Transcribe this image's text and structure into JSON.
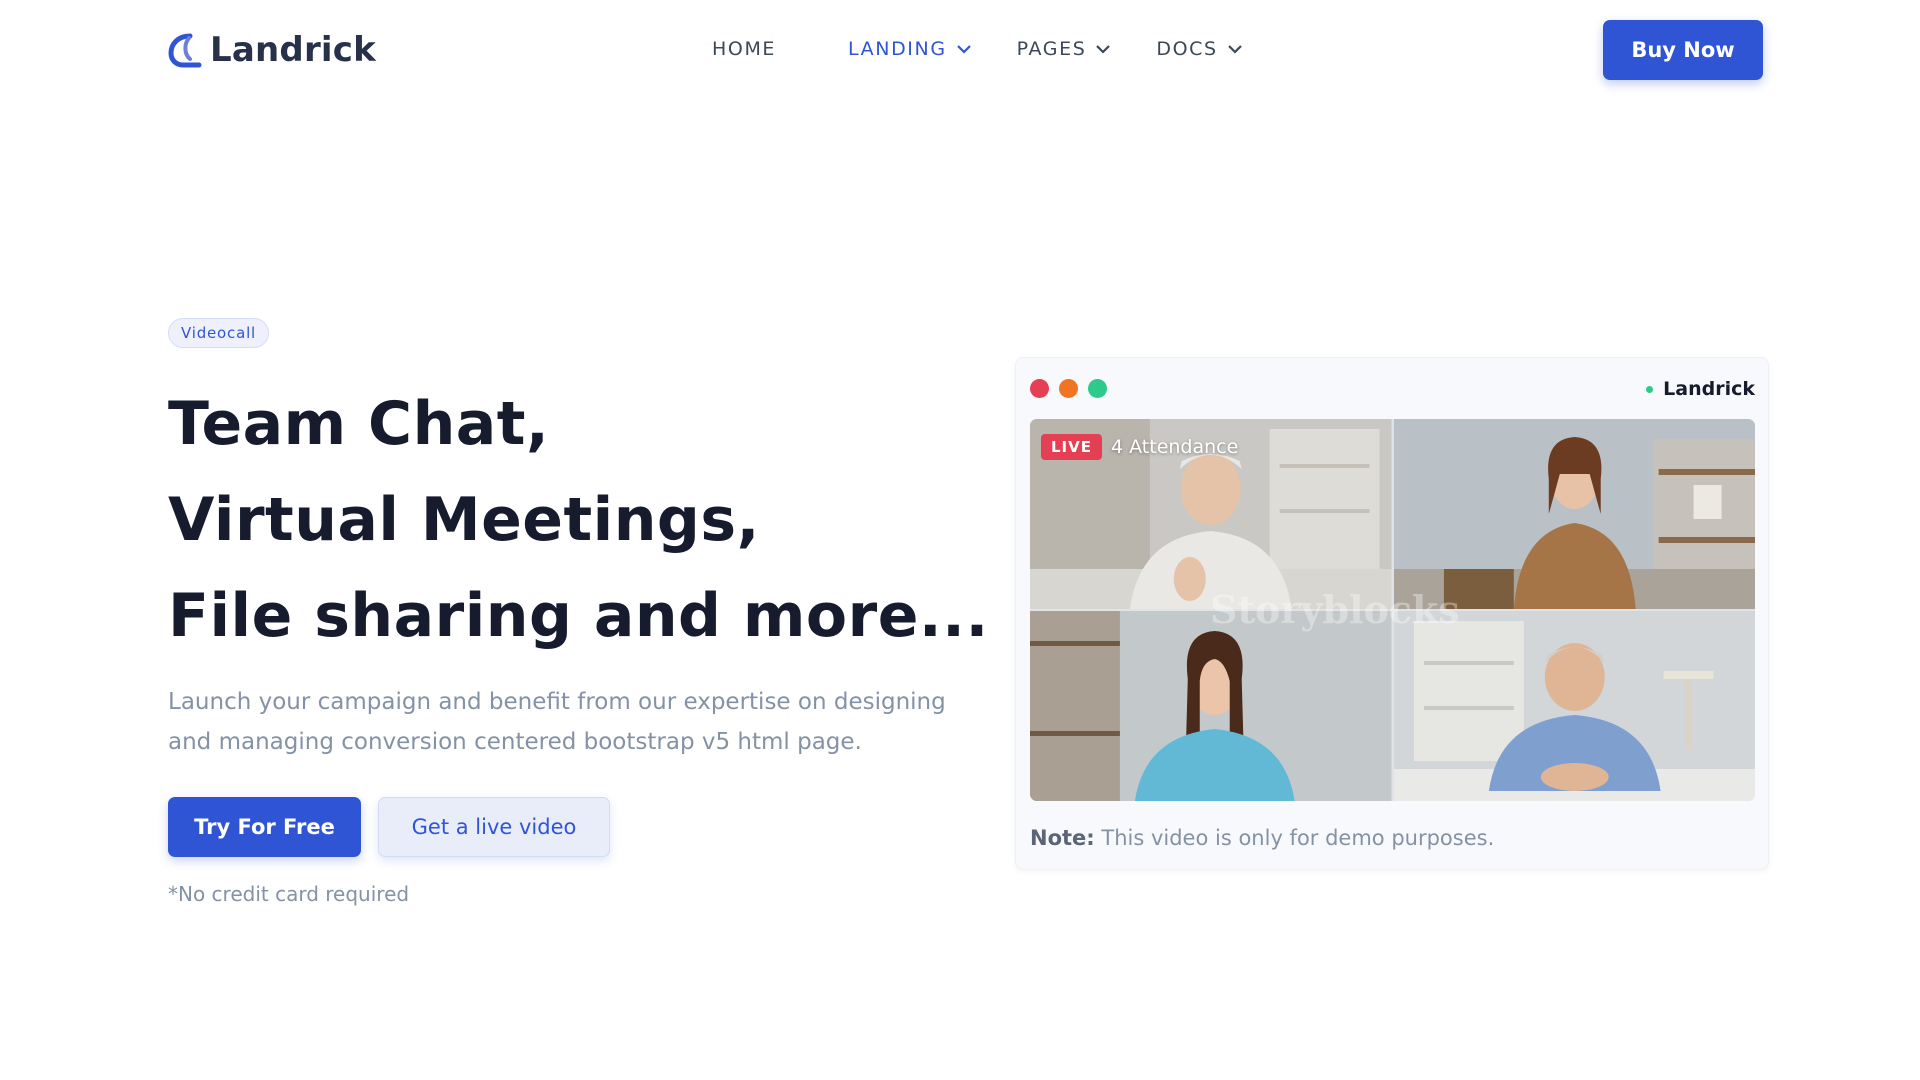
{
  "header": {
    "brand": "Landrick",
    "nav": [
      {
        "label": "HOME"
      },
      {
        "label": "LANDING"
      },
      {
        "label": "PAGES"
      },
      {
        "label": "DOCS"
      }
    ],
    "buy_label": "Buy Now"
  },
  "hero": {
    "badge": "Videocall",
    "headline_lines": [
      "Team Chat,",
      "Virtual Meetings,",
      "File sharing and more..."
    ],
    "lead": "Launch your campaign and benefit from our expertise on designing and managing conversion centered bootstrap v5 html page.",
    "primary_label": "Try For Free",
    "secondary_label": "Get a live video",
    "note": "*No credit card required"
  },
  "video_card": {
    "brand": "Landrick",
    "live_label": "LIVE",
    "attendance": "4 Attendance",
    "watermark": "Storyblocks",
    "note_label": "Note:",
    "note_text": "This video is only for demo purposes."
  },
  "colors": {
    "primary": "#2f55d4",
    "text_dark": "#161c2d",
    "muted": "#8492a6",
    "live_red": "#e43f52",
    "status_green": "#2eca8b"
  }
}
